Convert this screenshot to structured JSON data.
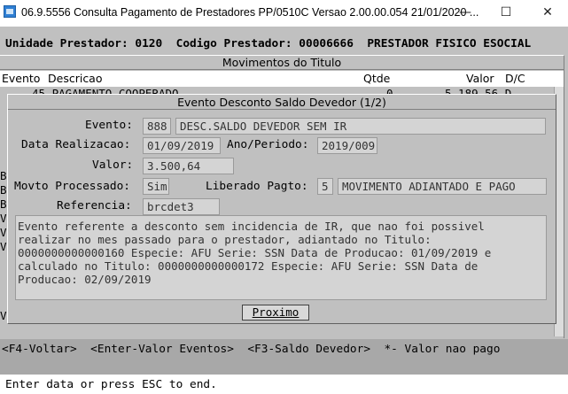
{
  "window": {
    "title": "06.9.5556  Consulta  Pagamento de Prestadores PP/0510C Versao 2.00.00.054 21/01/2020 ...",
    "icons": {
      "app": "app-window-icon",
      "minimize": "minimize-icon",
      "maximize": "maximize-icon",
      "close": "close-icon"
    },
    "controls": {
      "minimize": "—",
      "maximize": "☐",
      "close": "✕"
    }
  },
  "header": {
    "line": "Unidade Prestador: 0120  Codigo Prestador: 00006666  PRESTADOR FISICO ESOCIAL"
  },
  "movimentos": {
    "title": "Movimentos do Titulo",
    "columns": {
      "evento": "Evento",
      "descricao": "Descricao",
      "qtde": "Qtde",
      "valor": "Valor",
      "dc": "D/C"
    },
    "row_partial": {
      "text": "45 PAGAMENTO COOPERADO",
      "qtde": "0",
      "valor": "5.189,56 D"
    },
    "left_edge_chars": [
      "B",
      "B",
      "B",
      "V",
      "V",
      "V",
      "V"
    ]
  },
  "dialog": {
    "title": "Evento Desconto Saldo Devedor (1/2)",
    "labels": {
      "evento": "Evento:",
      "data_realizacao": "Data Realizacao:",
      "ano_periodo": "Ano/Periodo:",
      "valor": "Valor:",
      "movto_processado": "Movto Processado:",
      "liberado_pagto": "Liberado Pagto:",
      "referencia": "Referencia:"
    },
    "values": {
      "evento_code": "888",
      "evento_desc": "DESC.SALDO DEVEDOR SEM IR",
      "data_realizacao": "01/09/2019",
      "ano_periodo": "2019/009",
      "valor": "3.500,64",
      "movto_processado": "Sim",
      "liberado_code": "5",
      "liberado_desc": "MOVIMENTO ADIANTADO E PAGO",
      "referencia": "brcdet3"
    },
    "description": "Evento referente a desconto sem incidencia de IR, que nao foi possivel\nrealizar no mes passado para o prestador, adiantado no Titulo:\n0000000000000160 Especie: AFU Serie: SSN Data de Producao: 01/09/2019 e\ncalculado no Titulo: 0000000000000172 Especie: AFU Serie: SSN Data de\nProducao: 02/09/2019",
    "button_label": "Proximo"
  },
  "function_keys": "<F4-Voltar>  <Enter-Valor Eventos>  <F3-Saldo Devedor>  *- Valor nao pago",
  "status": "Enter data or press ESC to end."
}
